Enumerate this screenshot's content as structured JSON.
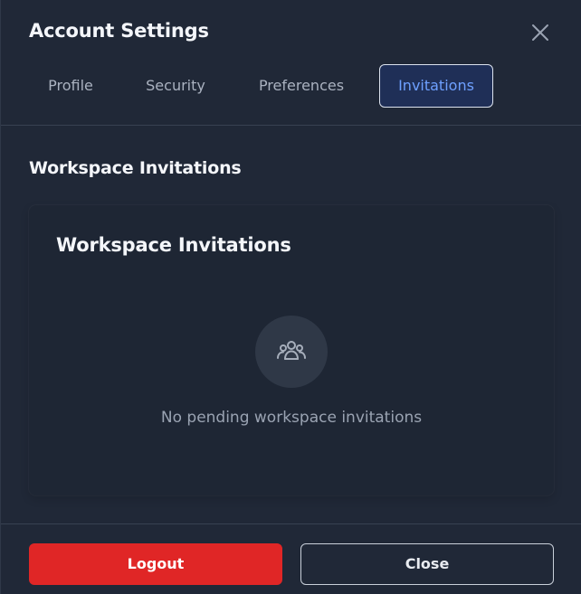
{
  "modal": {
    "title": "Account Settings",
    "close_icon": "close-icon"
  },
  "tabs": [
    {
      "label": "Profile",
      "active": false
    },
    {
      "label": "Security",
      "active": false
    },
    {
      "label": "Preferences",
      "active": false
    },
    {
      "label": "Invitations",
      "active": true
    }
  ],
  "section": {
    "title": "Workspace Invitations"
  },
  "card": {
    "title": "Workspace Invitations",
    "empty_icon": "users-group-icon",
    "empty_text": "No pending workspace invitations"
  },
  "footer": {
    "logout_label": "Logout",
    "close_label": "Close"
  },
  "colors": {
    "background": "#202837",
    "accent_tab_text": "#6ea0ff",
    "logout_button": "#e02626"
  }
}
